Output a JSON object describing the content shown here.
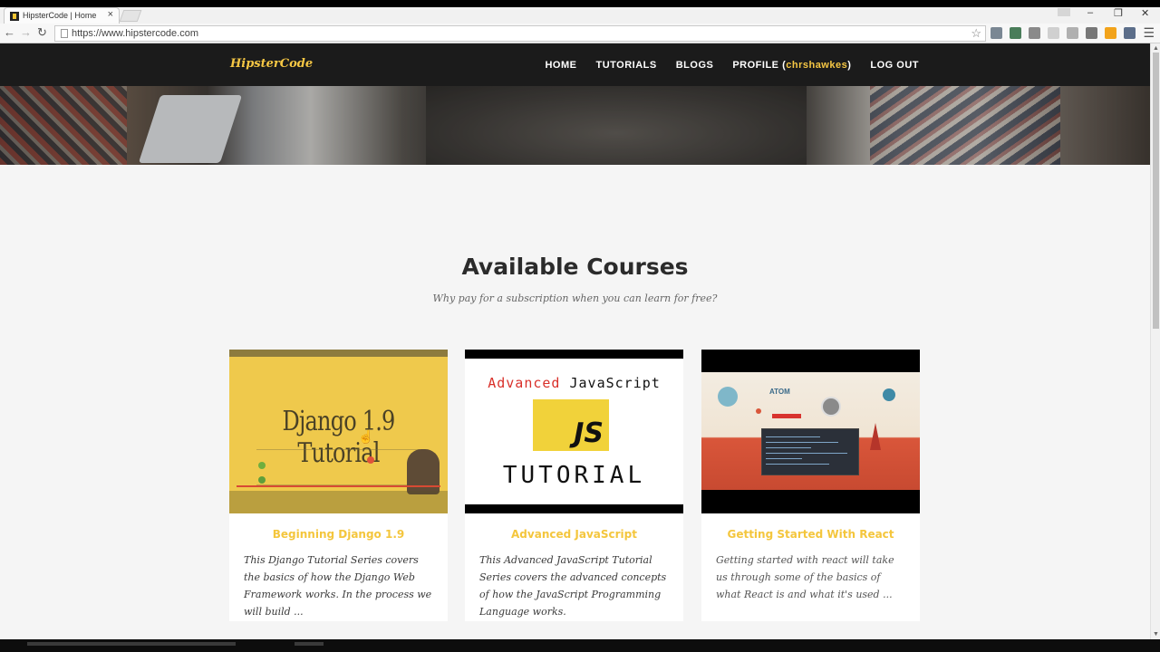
{
  "browser": {
    "tab_title": "HipsterCode | Home",
    "tab_close": "×",
    "url": "https://www.hipstercode.com",
    "controls": {
      "minimize": "–",
      "restore": "❐",
      "close": "✕"
    }
  },
  "site": {
    "logo": "HipsterCode",
    "nav": {
      "home": "HOME",
      "tutorials": "TUTORIALS",
      "blogs": "BLOGS",
      "profile_prefix": "PROFILE (",
      "profile_user": "chrshawkes",
      "profile_suffix": ")",
      "logout": "LOG OUT"
    },
    "accent_color": "#f6c744"
  },
  "courses_section": {
    "title": "Available Courses",
    "subtitle": "Why pay for a subscription when you can learn for free?"
  },
  "courses": [
    {
      "title": "Beginning Django 1.9",
      "description": "This Django Tutorial Series covers the basics of how the Django Web Framework works. In the process we will build ...",
      "thumb_text": "Django 1.9 Tutorial"
    },
    {
      "title": "Advanced JavaScript",
      "description": "This Advanced JavaScript Tutorial Series covers the advanced concepts of how the JavaScript Programming Language works.",
      "thumb_line1_a": "Advanced",
      "thumb_line1_b": "JavaScript",
      "thumb_logo": "JS",
      "thumb_line3": "TUTORIAL"
    },
    {
      "title": "Getting Started With React",
      "description": "Getting started with react will take us through some of the basics of what React is and what it's used ...",
      "thumb_text": "ATOM"
    }
  ]
}
